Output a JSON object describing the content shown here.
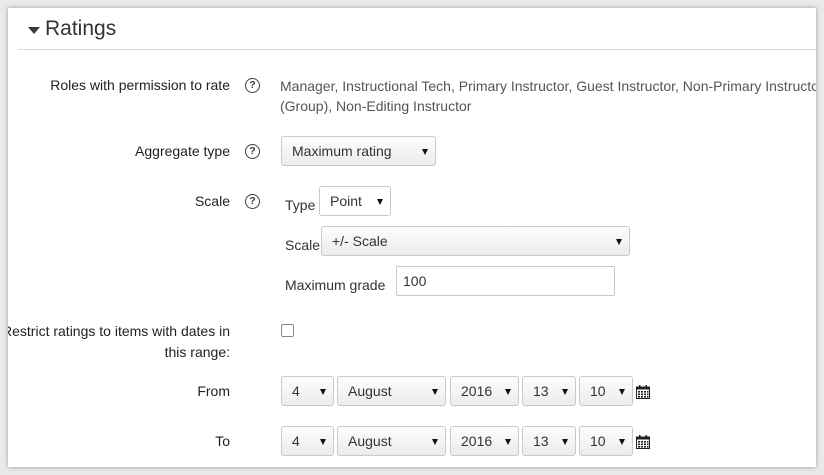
{
  "section": {
    "title": "Ratings"
  },
  "roles": {
    "label": "Roles with permission to rate",
    "help_glyph": "?",
    "value_line1": "Manager, Instructional Tech, Primary Instructor, Guest Instructor, Non-Primary Instructor",
    "value_line2": "(Group), Non-Editing Instructor"
  },
  "aggregate": {
    "label": "Aggregate type",
    "help_glyph": "?",
    "selected": "Maximum rating"
  },
  "scale": {
    "label": "Scale",
    "help_glyph": "?",
    "type_label": "Type",
    "type_selected": "Point",
    "scale_label": "Scale",
    "scale_selected": "+/- Scale",
    "max_grade_label": "Maximum grade",
    "max_grade_value": "100"
  },
  "restrict": {
    "label_line1": "Restrict ratings to items with dates in",
    "label_line2": "this range:",
    "checked": false
  },
  "from": {
    "label": "From",
    "day": "4",
    "month": "August",
    "year": "2016",
    "hour": "13",
    "minute": "10"
  },
  "to": {
    "label": "To",
    "day": "4",
    "month": "August",
    "year": "2016",
    "hour": "13",
    "minute": "10"
  },
  "icons": {
    "calendar": "calendar-icon",
    "help": "help-icon",
    "toggle": "chevron-down-icon"
  }
}
